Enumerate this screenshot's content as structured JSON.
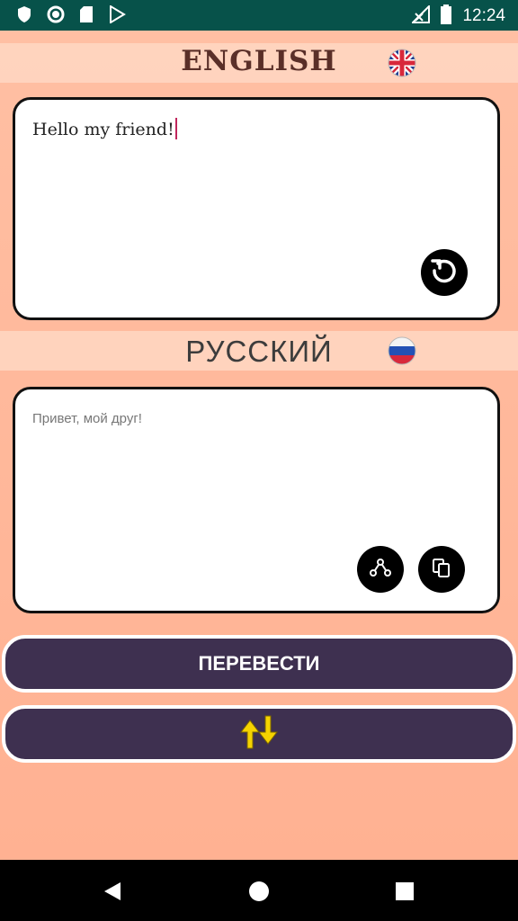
{
  "status_bar": {
    "time": "12:24",
    "left_icons": [
      "shield-icon",
      "circle-icon",
      "sd-card-icon",
      "play-store-icon"
    ],
    "right_icons": [
      "signal-icon",
      "battery-icon"
    ]
  },
  "source": {
    "language": "ENGLISH",
    "flag": "uk-flag-icon",
    "text": "Hello my friend!"
  },
  "target": {
    "language": "РУССКИЙ",
    "flag": "russia-flag-icon",
    "text": "Привет, мой друг!"
  },
  "buttons": {
    "translate_label": "ПЕРЕВЕСТИ",
    "swap_icon": "swap-arrows-icon",
    "reset_icon": "reset-icon",
    "share_icon": "share-icon",
    "copy_icon": "copy-icon"
  },
  "colors": {
    "status_bar": "#07524a",
    "background": "#ffb394",
    "button": "#3e3050",
    "swap_arrows": "#f5d300"
  }
}
